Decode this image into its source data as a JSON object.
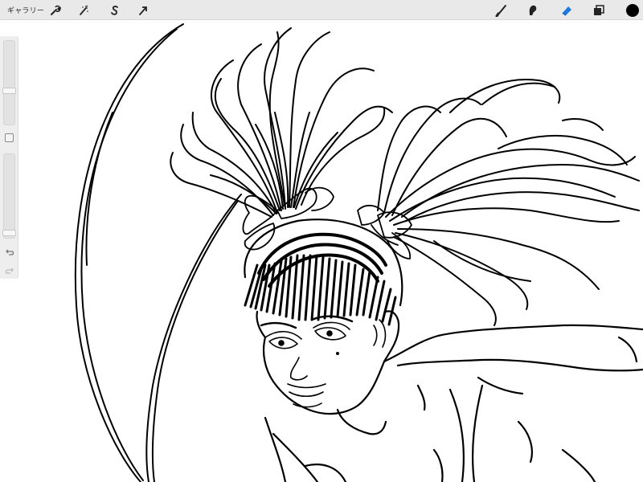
{
  "toolbar": {
    "gallery_label": "ギャラリー",
    "left_tools": [
      {
        "name": "actions",
        "icon": "wrench-icon"
      },
      {
        "name": "adjustments",
        "icon": "magic-wand-icon"
      },
      {
        "name": "selection",
        "icon": "selection-s-icon"
      },
      {
        "name": "transform",
        "icon": "arrow-cursor-icon"
      }
    ],
    "right_tools": [
      {
        "name": "brush",
        "icon": "brush-icon"
      },
      {
        "name": "smudge",
        "icon": "smudge-icon"
      },
      {
        "name": "eraser",
        "icon": "eraser-icon",
        "active": true
      },
      {
        "name": "layers",
        "icon": "layers-icon"
      },
      {
        "name": "color",
        "icon": "color-swatch-icon",
        "color": "#000000"
      }
    ],
    "accent_color": "#1f7ae0"
  },
  "sidebar": {
    "brush_size_level": 0.4,
    "opacity_level": 0.03,
    "modify_button": "square-modify-icon",
    "undo": "undo-icon",
    "redo": "redo-icon"
  },
  "canvas": {
    "background": "#ffffff",
    "ink_color": "#000000",
    "subject": "line-art-girl-with-twin-tails"
  }
}
